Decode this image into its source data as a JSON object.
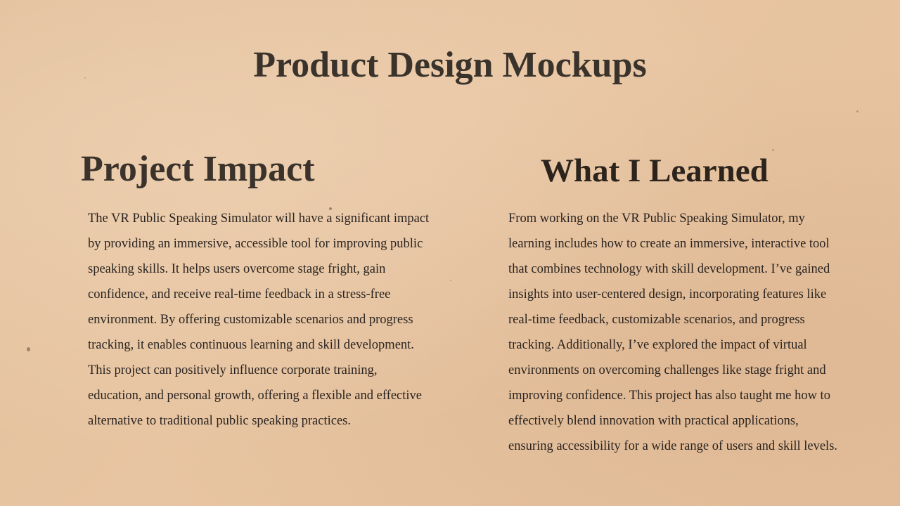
{
  "title": "Product Design Mockups",
  "left": {
    "heading": "Project Impact",
    "lines": [
      "The VR Public Speaking Simulator will have a significant impact",
      "by providing an immersive, accessible tool for improving public",
      "speaking skills. It helps users overcome stage fright, gain",
      "confidence, and receive real-time feedback in a stress-free",
      "environment. By offering customizable scenarios and progress",
      "tracking, it enables continuous learning and skill development.",
      "This project can positively influence corporate training,",
      "education, and personal growth, offering a flexible and effective",
      "alternative to traditional public speaking practices."
    ]
  },
  "right": {
    "heading": "What I Learned",
    "lines": [
      "From working on the VR Public Speaking Simulator, my",
      "learning includes how to create an immersive, interactive tool",
      "that combines technology with skill development. I’ve gained",
      "insights into user-centered design, incorporating features like",
      "real-time feedback, customizable scenarios, and progress",
      "tracking. Additionally, I’ve explored the impact of virtual",
      "environments on overcoming challenges like stage fright and",
      "improving confidence. This project has also taught me how to",
      "effectively blend innovation with practical applications,",
      "ensuring accessibility for a wide range of users and skill levels."
    ]
  }
}
